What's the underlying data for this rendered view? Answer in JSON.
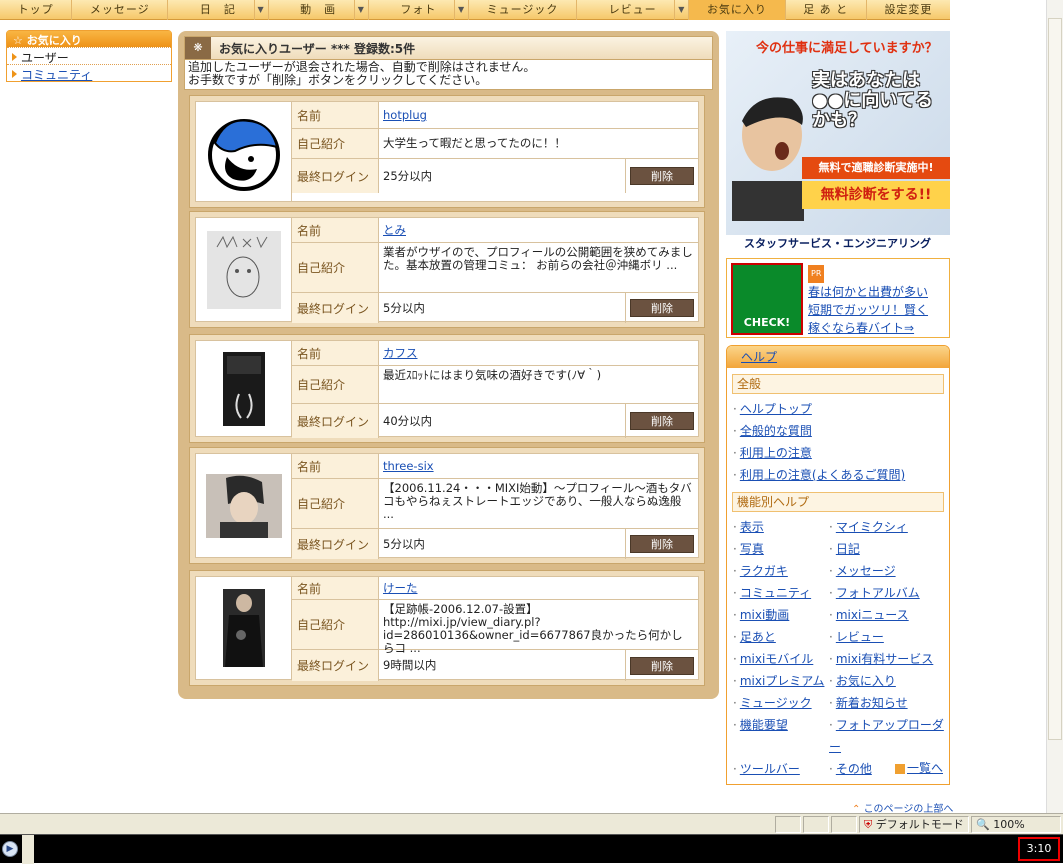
{
  "topnav": {
    "items": [
      {
        "label": "トップ"
      },
      {
        "label": "メッセージ"
      },
      {
        "label": "日　記"
      },
      {
        "label": "動　画"
      },
      {
        "label": "フォト"
      },
      {
        "label": "ミュージック"
      },
      {
        "label": "レビュー"
      },
      {
        "label": "お気に入り"
      },
      {
        "label": "足 あ と"
      },
      {
        "label": "設定変更"
      }
    ],
    "active": "お気に入り"
  },
  "leftmenu": {
    "header": "お気に入り",
    "items": [
      {
        "label": "ユーザー"
      },
      {
        "label": "コミュニティ"
      }
    ]
  },
  "main": {
    "title": "お気に入りユーザー *** 登録数:5件",
    "notice_line1": "追加したユーザーが退会された場合、自動で削除はされません。",
    "notice_line2": "お手数ですが「削除」ボタンをクリックしてください。",
    "field_labels": {
      "name": "名前",
      "intro": "自己紹介",
      "last_login": "最終ログイン"
    },
    "delete_label": "削除",
    "users": [
      {
        "name": "hotplug",
        "intro": "大学生って暇だと思ってたのに！！",
        "last_login": "25分以内"
      },
      {
        "name": "とみ",
        "intro": "業者がウザイので、プロフィールの公開範囲を狭めてみました。基本放置の管理コミュ： お前らの会社＠沖縄ボリ ...",
        "last_login": "5分以内"
      },
      {
        "name": "カフス",
        "intro": "最近ｽﾛｯﾄにはまり気味の酒好きです(ﾉ∀｀)",
        "last_login": "40分以内"
      },
      {
        "name": "three-six",
        "intro": "【2006.11.24・・・MIXI始動】〜プロフィール〜酒もタバコもやらねぇストレートエッジであり、一般人ならぬ逸般 ...",
        "last_login": "5分以内"
      },
      {
        "name": "けーた",
        "intro": "【足跡帳-2006.12.07-設置】http://mixi.jp/view_diary.pl?id=286010136&owner_id=6677867良かったら何かしらコ ...",
        "last_login": "9時間以内"
      }
    ]
  },
  "ad1": {
    "title": "今の仕事に満足していますか？",
    "big": "実はあなたは●●に向いてるかも？",
    "strip": "無料で適職診断実施中!",
    "button": "無料診断をする!!",
    "footer": "スタッフサービス・エンジニアリング"
  },
  "ad2": {
    "badge": "CHECK!",
    "pr": "PR",
    "links": [
      "春は何かと出費が多い",
      "短期でガッツリ！賢く",
      "稼ぐなら春バイト⇒"
    ]
  },
  "help": {
    "header": "ヘルプ",
    "general_title": "全般",
    "general_links": [
      "ヘルプトップ",
      "全般的な質問",
      "利用上の注意",
      "利用上の注意(よくあるご質問)"
    ],
    "feature_title": "機能別ヘルプ",
    "feature_links": [
      "表示",
      "マイミクシィ",
      "写真",
      "日記",
      "ラクガキ",
      "メッセージ",
      "コミュニティ",
      "フォトアルバム",
      "mixi動画",
      "mixiニュース",
      "足あと",
      "レビュー",
      "mixiモバイル",
      "mixi有料サービス",
      "mixiプレミアム",
      "お気に入り",
      "ミュージック",
      "新着お知らせ",
      "機能要望",
      "フォトアップローダー",
      "ツールバー",
      "その他"
    ],
    "more": "一覧へ"
  },
  "pagetop": "このページの上部へ",
  "statusbar": {
    "mode": "デフォルトモード",
    "zoom": "100%"
  },
  "taskbar": {
    "clock": "3:10"
  }
}
